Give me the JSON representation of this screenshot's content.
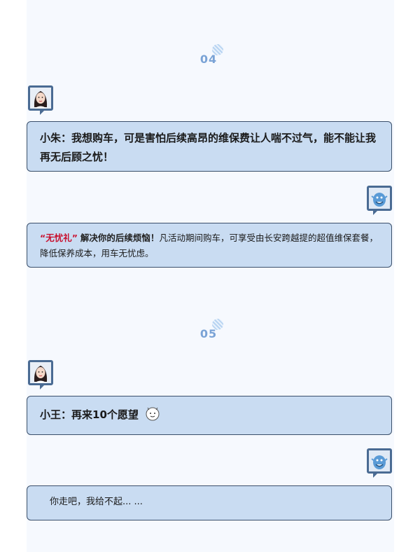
{
  "sections": [
    {
      "number": "04",
      "question": "小朱：我想购车，可是害怕后续高昂的维保费让人喘不过气，能不能让我再无后顾之忧！",
      "answer": {
        "highlight": "“无忧礼”",
        "lead": "解决你的后续烦恼！",
        "rest": "凡活动期间购车，可享受由长安跨越提的超值维保套餐，降低保养成本，用车无忧虑。"
      }
    },
    {
      "number": "05",
      "question": "小王：再来10个愿望",
      "answer": {
        "text": "你走吧，我给不起... ..."
      }
    }
  ],
  "icons": {
    "asker_avatar": "woman-portrait-icon",
    "answerer_avatar": "genie-icon",
    "sticker": "cartoon-face-sticker-icon",
    "section_dot": "striped-circle-icon"
  },
  "colors": {
    "bubble_bg": "#c9dcf2",
    "bubble_border": "#3a4f6a",
    "section_number": "#7aa3d6",
    "highlight": "#c8102e",
    "avatar_frame": "#4a6b93"
  }
}
